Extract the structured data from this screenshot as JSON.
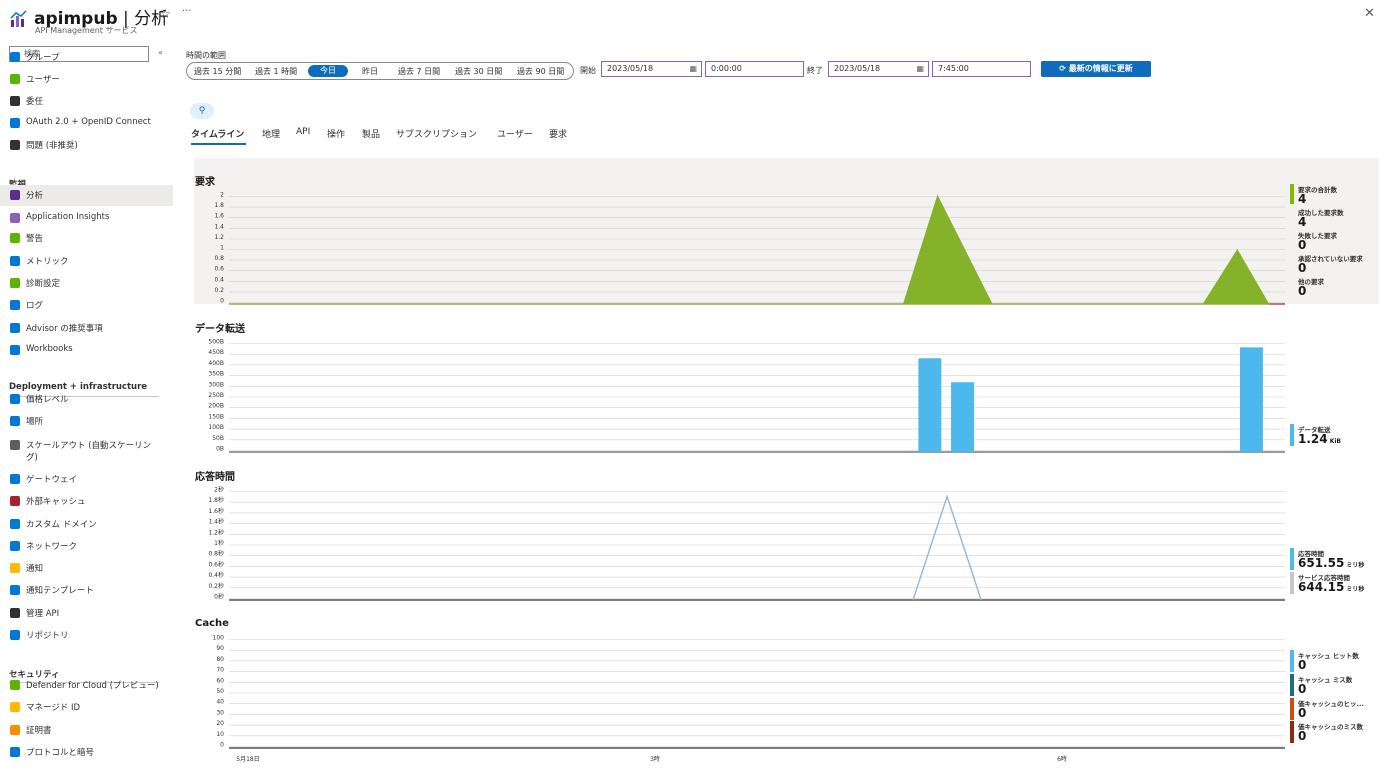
{
  "header": {
    "title_main": "apimpub",
    "title_sep": " | ",
    "title_page": "分析",
    "subtitle": "API Management サービス"
  },
  "sidebar": {
    "search_placeholder": "検索",
    "items_top": [
      {
        "label": "グループ",
        "icon": "group-icon",
        "color": "#0078d4"
      },
      {
        "label": "ユーザー",
        "icon": "user-icon",
        "color": "#5db300"
      },
      {
        "label": "委任",
        "icon": "delegation-icon",
        "color": "#323130"
      },
      {
        "label": "OAuth 2.0 + OpenID Connect",
        "icon": "shield-icon",
        "color": "#0078d4"
      },
      {
        "label": "問題 (非推奨)",
        "icon": "issue-icon",
        "color": "#323130"
      }
    ],
    "monitoring_header": "監視",
    "monitoring_items": [
      {
        "label": "分析",
        "icon": "analytics-icon",
        "color": "#5c2d91",
        "active": true
      },
      {
        "label": "Application Insights",
        "icon": "app-insights-icon",
        "color": "#8764b8"
      },
      {
        "label": "警告",
        "icon": "alert-icon",
        "color": "#5db300"
      },
      {
        "label": "メトリック",
        "icon": "metrics-icon",
        "color": "#0078d4"
      },
      {
        "label": "診断設定",
        "icon": "diagnostic-icon",
        "color": "#5db300"
      },
      {
        "label": "ログ",
        "icon": "logs-icon",
        "color": "#0078d4"
      },
      {
        "label": "Advisor の推奨事項",
        "icon": "advisor-icon",
        "color": "#0078d4"
      },
      {
        "label": "Workbooks",
        "icon": "workbooks-icon",
        "color": "#0078d4"
      }
    ],
    "deployment_header": "Deployment + infrastructure",
    "deployment_items": [
      {
        "label": "価格レベル",
        "icon": "pricing-icon",
        "color": "#0078d4"
      },
      {
        "label": "場所",
        "icon": "location-icon",
        "color": "#0078d4"
      },
      {
        "label": "スケールアウト (自動スケーリン",
        "label2": "グ)",
        "icon": "scale-icon",
        "color": "#605e5c"
      },
      {
        "label": "ゲートウェイ",
        "icon": "gateway-icon",
        "color": "#0078d4"
      },
      {
        "label": "外部キャッシュ",
        "icon": "cache-icon",
        "color": "#a4262c"
      },
      {
        "label": "カスタム ドメイン",
        "icon": "domain-icon",
        "color": "#0078d4"
      },
      {
        "label": "ネットワーク",
        "icon": "network-icon",
        "color": "#0078d4"
      },
      {
        "label": "通知",
        "icon": "bell-icon",
        "color": "#ffb900"
      },
      {
        "label": "通知テンプレート",
        "icon": "mail-icon",
        "color": "#0078d4"
      },
      {
        "label": "管理 API",
        "icon": "api-icon",
        "color": "#323130"
      },
      {
        "label": "リポジトリ",
        "icon": "repo-icon",
        "color": "#0078d4"
      }
    ],
    "security_header": "セキュリティ",
    "security_items": [
      {
        "label": "Defender for Cloud (プレビュー)",
        "icon": "defender-icon",
        "color": "#5db300"
      },
      {
        "label": "マネージド ID",
        "icon": "key-icon",
        "color": "#ffb900"
      },
      {
        "label": "証明書",
        "icon": "certificate-icon",
        "color": "#ff8c00"
      },
      {
        "label": "プロトコルと暗号",
        "icon": "protocol-icon",
        "color": "#0078d4"
      }
    ]
  },
  "toolbar": {
    "range_label": "時間の範囲",
    "range_options": [
      "過去 15 分間",
      "過去 1 時間",
      "今日",
      "昨日",
      "過去 7 日間",
      "過去 30 日間",
      "過去 90 日間"
    ],
    "selected_range": "今日",
    "start_label": "開始",
    "start_date": "2023/05/18",
    "start_time": "0:00:00",
    "end_label": "終了",
    "end_date": "2023/05/18",
    "end_time": "7:45:00",
    "refresh_label": "最新の情報に更新"
  },
  "tabs": [
    "タイムライン",
    "地理",
    "API",
    "操作",
    "製品",
    "サブスクリプション",
    "ユーザー",
    "要求"
  ],
  "active_tab": "タイムライン",
  "charts": {
    "requests": {
      "title": "要求",
      "legend": [
        {
          "name": "要求の合計数",
          "value": "4",
          "color": "#7fba00"
        },
        {
          "name": "成功した要求数",
          "value": "4",
          "color": ""
        },
        {
          "name": "失敗した要求",
          "value": "0",
          "color": ""
        },
        {
          "name": "承認されていない要求",
          "value": "0",
          "color": ""
        },
        {
          "name": "他の要求",
          "value": "0",
          "color": ""
        }
      ]
    },
    "transfer": {
      "title": "データ転送",
      "legend": [
        {
          "name": "データ転送",
          "value": "1.24",
          "unit": "KiB",
          "color": "#4db8eb"
        }
      ]
    },
    "response": {
      "title": "応答時間",
      "legend": [
        {
          "name": "応答時間",
          "value": "651.55",
          "unit": "ミリ秒",
          "color": "#4db8eb"
        },
        {
          "name": "サービス応答時間",
          "value": "644.15",
          "unit": "ミリ秒",
          "color": "#c8c6c4"
        }
      ]
    },
    "cache": {
      "title": "Cache",
      "legend": [
        {
          "name": "キャッシュ ヒット数",
          "value": "0",
          "color": "#4db8eb"
        },
        {
          "name": "キャッシュ ミス数",
          "value": "0",
          "color": "#1b6a87"
        },
        {
          "name": "価キャッシュのヒッ...",
          "value": "0",
          "color": "#ca5010"
        },
        {
          "name": "価キャッシュのミス数",
          "value": "0",
          "color": "#8e2b0e"
        }
      ]
    }
  },
  "chart_data": [
    {
      "type": "area",
      "title": "要求",
      "x_ticks": [
        "5月18日",
        "3時",
        "6時"
      ],
      "ylim": [
        0,
        2
      ],
      "y_ticks": [
        "0",
        "0.2",
        "0.4",
        "0.6",
        "0.8",
        "1",
        "1.2",
        "1.4",
        "1.6",
        "1.8",
        "2"
      ],
      "series": [
        {
          "name": "要求の合計数",
          "points": [
            [
              0,
              0
            ],
            [
              4.95,
              0
            ],
            [
              5.2,
              2
            ],
            [
              5.6,
              0
            ],
            [
              7.15,
              0
            ],
            [
              7.4,
              1
            ],
            [
              7.63,
              0
            ]
          ]
        }
      ]
    },
    {
      "type": "bar",
      "title": "データ転送",
      "ylim": [
        0,
        500
      ],
      "y_ticks": [
        "0B",
        "50B",
        "100B",
        "150B",
        "200B",
        "250B",
        "300B",
        "350B",
        "400B",
        "450B",
        "500B"
      ],
      "series": [
        {
          "name": "データ転送",
          "points": [
            [
              5.14,
              430
            ],
            [
              5.38,
              320
            ],
            [
              7.5,
              480
            ]
          ]
        }
      ]
    },
    {
      "type": "line",
      "title": "応答時間",
      "ylim": [
        0,
        2
      ],
      "y_ticks": [
        "0秒",
        "0.2秒",
        "0.4秒",
        "0.6秒",
        "0.8秒",
        "1秒",
        "1.2秒",
        "1.4秒",
        "1.6秒",
        "1.8秒",
        "2秒"
      ],
      "series": [
        {
          "name": "応答時間",
          "points": [
            [
              5.02,
              0
            ],
            [
              5.27,
              1.9
            ],
            [
              5.52,
              0
            ]
          ]
        }
      ]
    },
    {
      "type": "line",
      "title": "Cache",
      "ylim": [
        0,
        100
      ],
      "y_ticks": [
        "0",
        "10",
        "20",
        "30",
        "40",
        "50",
        "60",
        "70",
        "80",
        "90",
        "100"
      ],
      "series": []
    }
  ]
}
